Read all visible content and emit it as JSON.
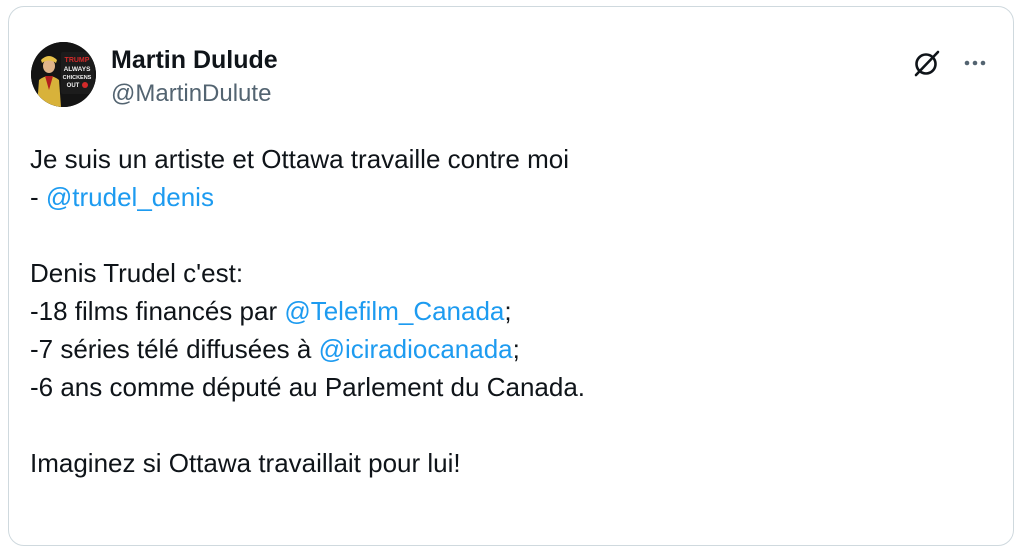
{
  "author": {
    "name": "Martin Dulude",
    "handle": "@MartinDulute",
    "avatar_sign_text": [
      "TRUMP",
      "ALWAYS",
      "CHICKENS",
      "OUT"
    ]
  },
  "actions": {
    "grok_icon": "grok-icon",
    "more_icon": "more-icon"
  },
  "tweet": {
    "line1": "Je suis un artiste et Ottawa travaille contre moi",
    "line2_prefix": "- ",
    "mention1": "@trudel_denis",
    "line3": "Denis Trudel c'est:",
    "line4_prefix": "-18 films financés par ",
    "mention2": "@Telefilm_Canada",
    "line4_suffix": ";",
    "line5_prefix": "-7 séries télé diffusées à ",
    "mention3": "@iciradiocanada",
    "line5_suffix": ";",
    "line6": "-6 ans comme député au Parlement du Canada.",
    "line7": "Imaginez si Ottawa travaillait pour lui!"
  },
  "colors": {
    "mention": "#1d9bf0",
    "text": "#0f1419",
    "secondary": "#536471",
    "border": "#cfd9de"
  }
}
